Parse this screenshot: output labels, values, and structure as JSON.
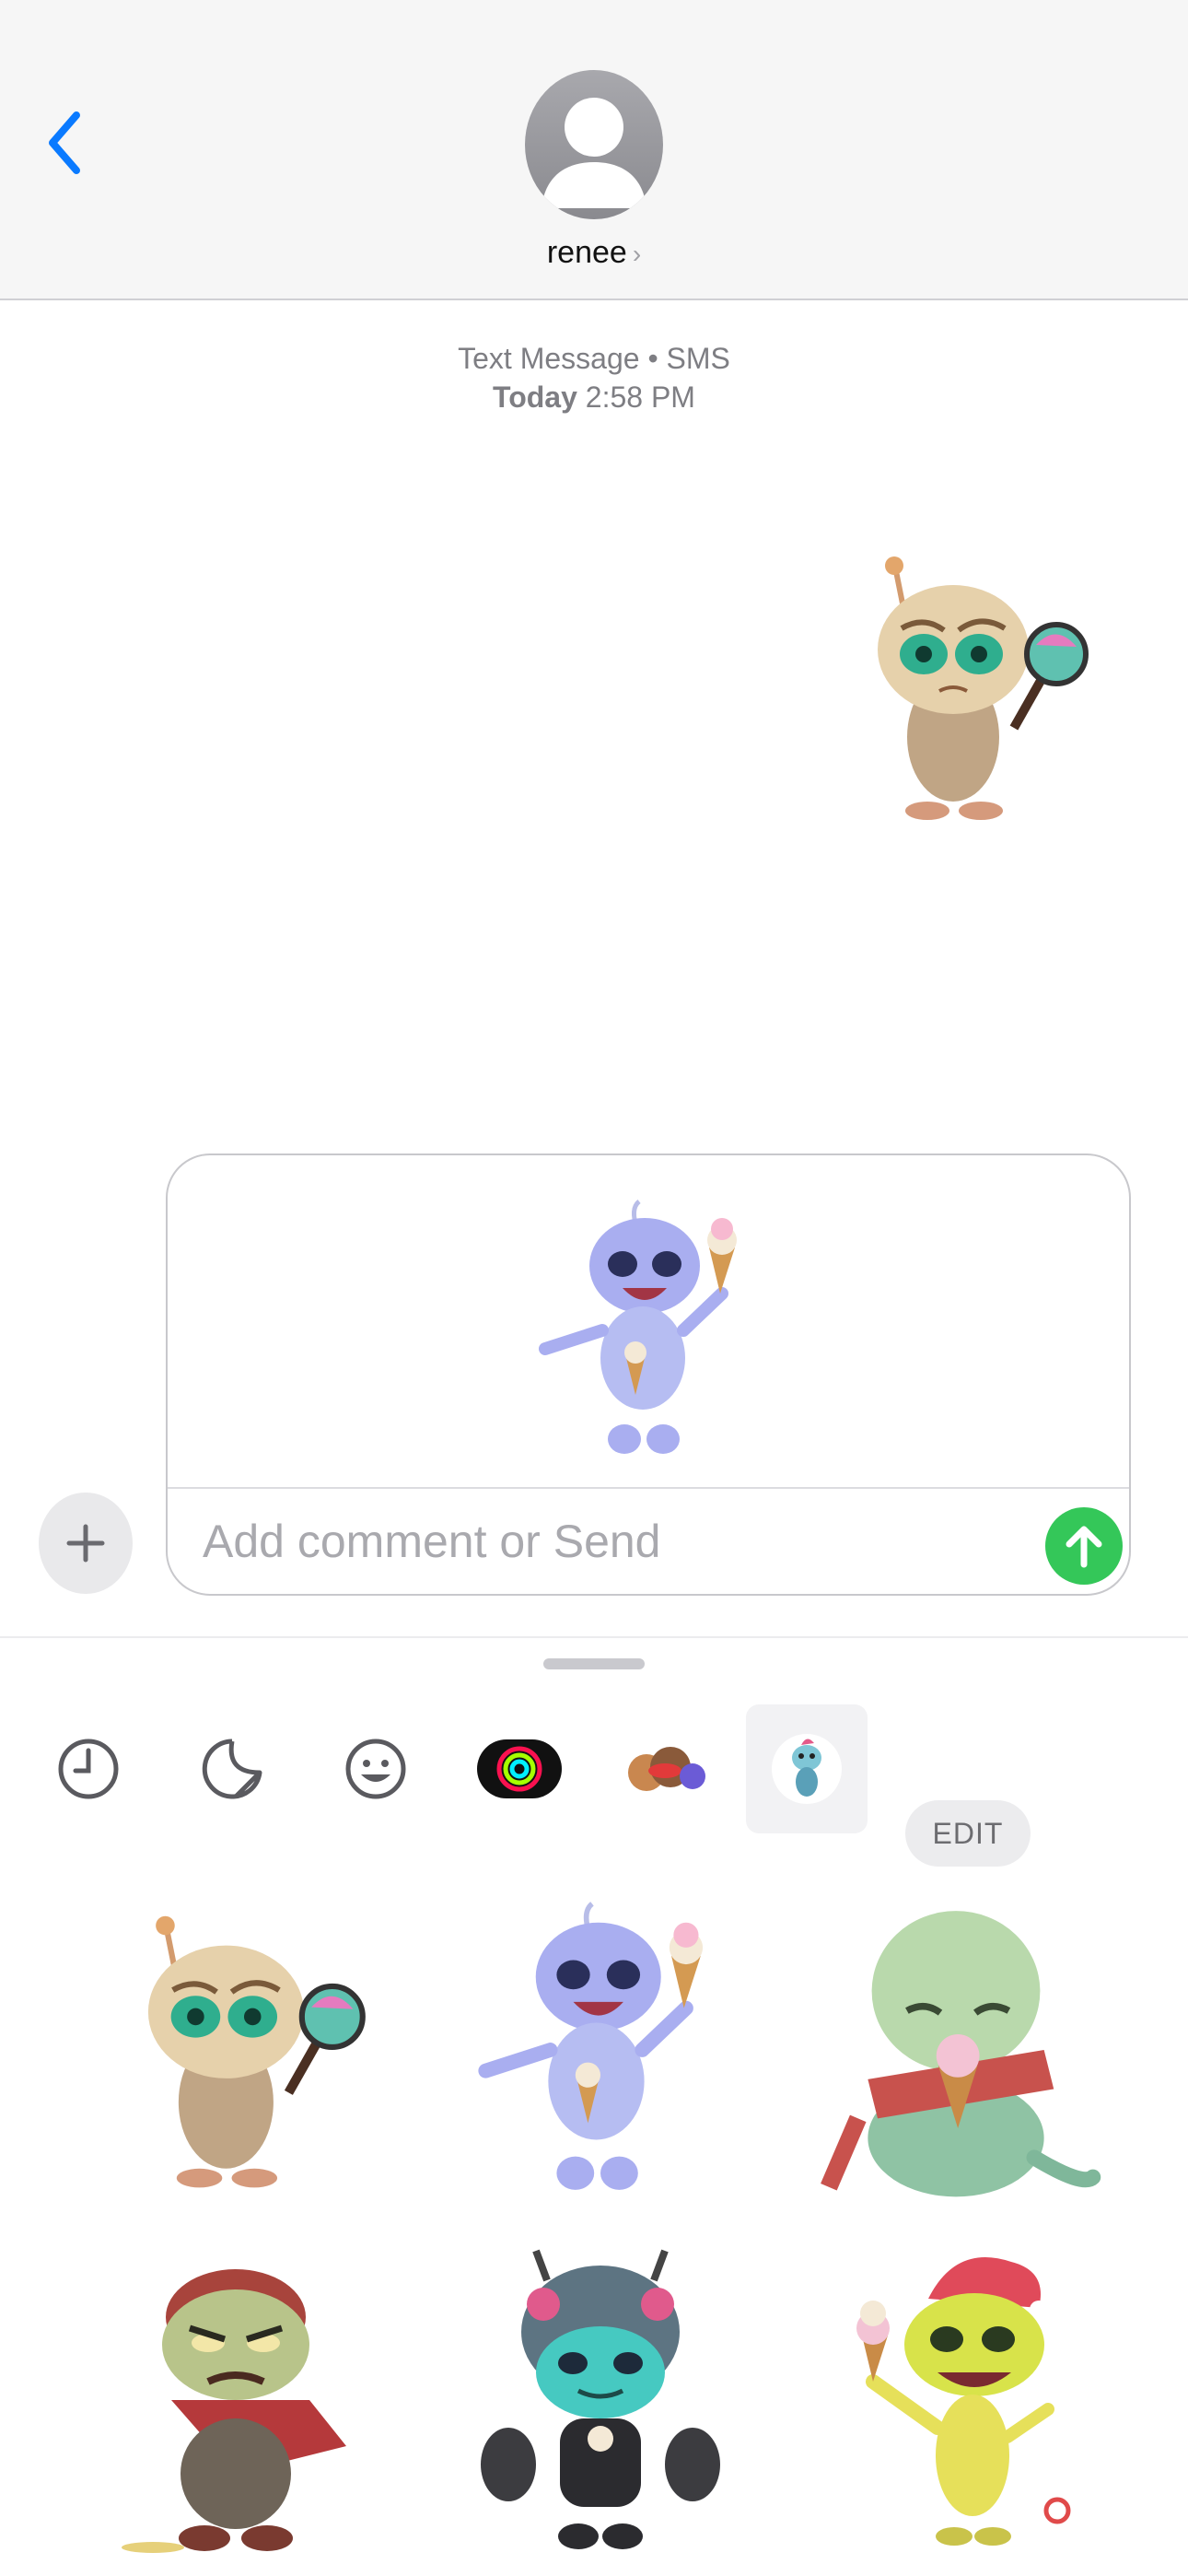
{
  "header": {
    "contact_name": "renee",
    "back_icon": "chevron-left-icon",
    "avatar_icon": "person-silhouette-icon"
  },
  "conversation": {
    "service_label": "Text Message • SMS",
    "day": "Today",
    "time": "2:58 PM",
    "sent_sticker": "alien-magnifying-glass-sticker"
  },
  "compose": {
    "plus_icon": "plus-icon",
    "attached_sticker": "alien-ice-cream-blue-sticker",
    "placeholder": "Add comment or Send",
    "send_icon": "arrow-up-icon"
  },
  "drawer": {
    "tabs": [
      {
        "icon": "clock-icon"
      },
      {
        "icon": "sticker-peel-icon"
      },
      {
        "icon": "smiley-icon"
      },
      {
        "icon": "activity-rings-icon"
      },
      {
        "icon": "memoji-stickers-icon"
      },
      {
        "icon": "alien-sticker-pack-icon",
        "selected": true
      }
    ],
    "edit_label": "EDIT",
    "stickers": [
      "alien-magnifying-glass-sticker",
      "alien-ice-cream-blue-sticker",
      "alien-green-ice-cream-scarf-sticker",
      "alien-angry-bandana-sticker",
      "alien-helmet-dumbbells-sticker",
      "alien-jester-ice-cream-sticker"
    ]
  },
  "colors": {
    "accent_blue": "#0a7aff",
    "send_green": "#34c759",
    "header_bg": "#f6f6f6"
  }
}
